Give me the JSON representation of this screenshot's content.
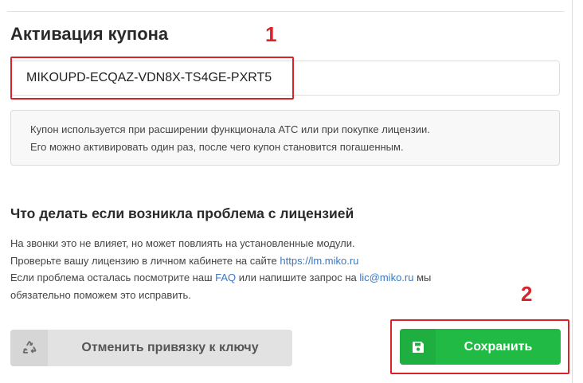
{
  "coupon": {
    "title": "Активация купона",
    "value": "MIKOUPD-ECQAZ-VDN8X-TS4GE-PXRT5",
    "info_line_1": "Купон используется при расширении функционала АТС или при покупке лицензии.",
    "info_line_2": "Его можно активировать один раз, после чего купон становится погашенным."
  },
  "markers": {
    "first": "1",
    "second": "2"
  },
  "problem": {
    "title": "Что делать если возникла проблема с лицензией",
    "line_1": "На звонки это не влияет, но может повлиять на установленные модули.",
    "line_2_prefix": "Проверьте вашу лицензию в личном кабинете на сайте",
    "license_link": "https://lm.miko.ru",
    "line_3_prefix": "Если проблема осталась посмотрите наш",
    "faq_link": "FAQ",
    "line_3_middle": "или напишите запрос на",
    "email_link": "lic@miko.ru",
    "line_3_suffix": "мы",
    "line_4": "обязательно поможем это исправить."
  },
  "buttons": {
    "unlink_label": "Отменить привязку к ключу",
    "unlink_icon": "recycle-icon",
    "save_label": "Сохранить",
    "save_icon": "save-icon"
  },
  "colors": {
    "highlight": "#d9232a",
    "save_button": "#21ba45",
    "link": "#3b78c2"
  }
}
